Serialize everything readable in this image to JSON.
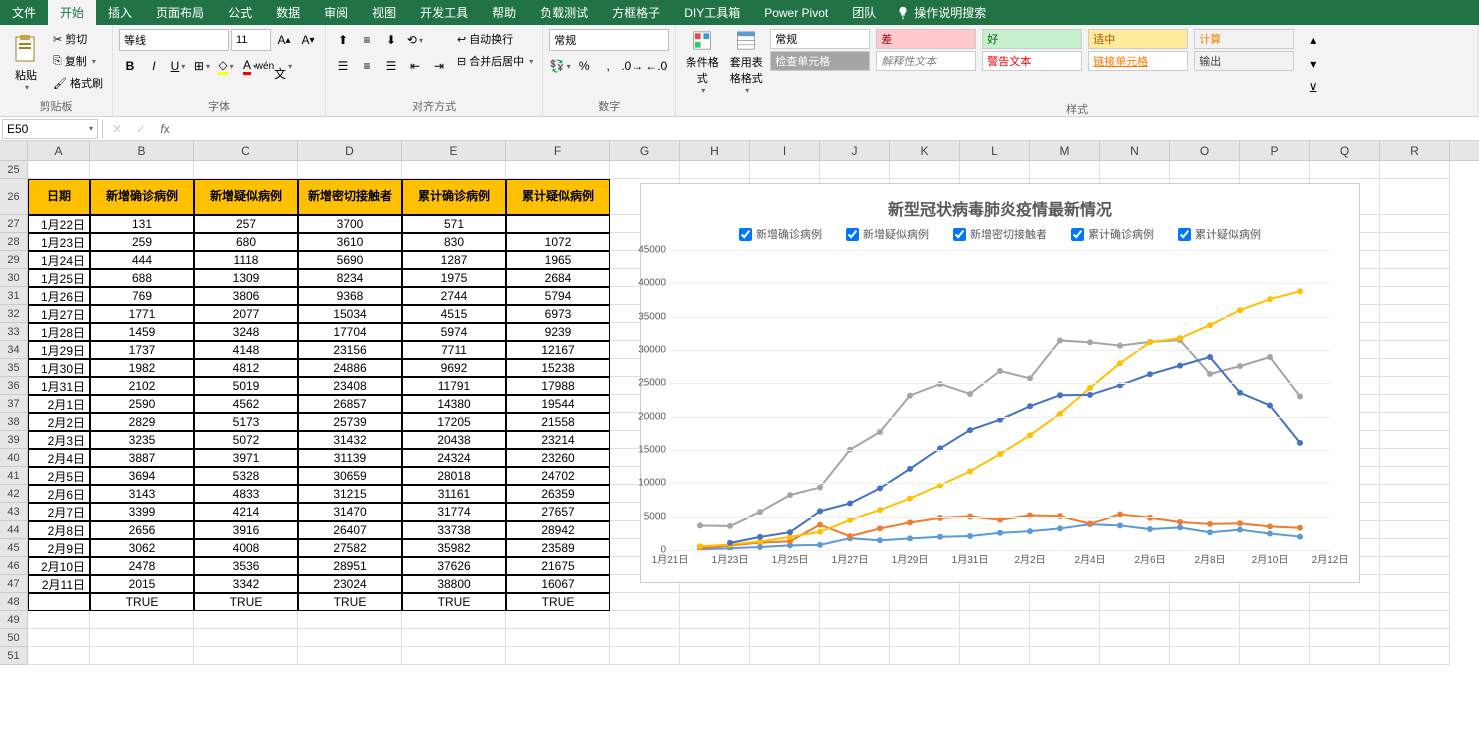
{
  "ribbon_tabs": [
    "文件",
    "开始",
    "插入",
    "页面布局",
    "公式",
    "数据",
    "审阅",
    "视图",
    "开发工具",
    "帮助",
    "负载测试",
    "方框格子",
    "DIY工具箱",
    "Power Pivot",
    "团队"
  ],
  "active_tab": "开始",
  "tellme": "操作说明搜索",
  "clipboard": {
    "paste": "粘贴",
    "cut": "剪切",
    "copy": "复制",
    "format_painter": "格式刷",
    "group": "剪贴板"
  },
  "font": {
    "name": "等线",
    "size": "11",
    "group": "字体",
    "bold": "B",
    "italic": "I",
    "underline": "U"
  },
  "alignment": {
    "wrap": "自动换行",
    "merge": "合并后居中",
    "group": "对齐方式"
  },
  "number": {
    "format": "常规",
    "group": "数字"
  },
  "cond_format": "条件格式",
  "table_format": "套用表格格式",
  "styles": {
    "group": "样式",
    "cells": [
      {
        "t": "常规",
        "bg": "#fff",
        "fg": "#000"
      },
      {
        "t": "差",
        "bg": "#ffc7ce",
        "fg": "#9c0006"
      },
      {
        "t": "好",
        "bg": "#c6efce",
        "fg": "#006100"
      },
      {
        "t": "适中",
        "bg": "#ffeb9c",
        "fg": "#9c5700"
      },
      {
        "t": "计算",
        "bg": "#f2f2f2",
        "fg": "#fa7d00"
      },
      {
        "t": "检查单元格",
        "bg": "#a5a5a5",
        "fg": "#fff"
      },
      {
        "t": "解释性文本",
        "bg": "#fff",
        "fg": "#7f7f7f",
        "italic": true
      },
      {
        "t": "警告文本",
        "bg": "#fff",
        "fg": "#ff0000"
      },
      {
        "t": "链接单元格",
        "bg": "#fff",
        "fg": "#fa7d00",
        "underline": true
      },
      {
        "t": "输出",
        "bg": "#f2f2f2",
        "fg": "#3f3f3f"
      }
    ]
  },
  "name_box": "E50",
  "formula": "",
  "columns": [
    "A",
    "B",
    "C",
    "D",
    "E",
    "F",
    "G",
    "H",
    "I",
    "J",
    "K",
    "L",
    "M",
    "N",
    "O",
    "P",
    "Q",
    "R"
  ],
  "table_headers": [
    "日期",
    "新增确诊病例",
    "新增疑似病例",
    "新增密切接触者",
    "累计确诊病例",
    "累计疑似病例"
  ],
  "data_rows": [
    [
      "1月22日",
      131,
      257,
      3700,
      571,
      ""
    ],
    [
      "1月23日",
      259,
      680,
      3610,
      830,
      1072
    ],
    [
      "1月24日",
      444,
      1118,
      5690,
      1287,
      1965
    ],
    [
      "1月25日",
      688,
      1309,
      8234,
      1975,
      2684
    ],
    [
      "1月26日",
      769,
      3806,
      9368,
      2744,
      5794
    ],
    [
      "1月27日",
      1771,
      2077,
      15034,
      4515,
      6973
    ],
    [
      "1月28日",
      1459,
      3248,
      17704,
      5974,
      9239
    ],
    [
      "1月29日",
      1737,
      4148,
      23156,
      7711,
      12167
    ],
    [
      "1月30日",
      1982,
      4812,
      24886,
      9692,
      15238
    ],
    [
      "1月31日",
      2102,
      5019,
      23408,
      11791,
      17988
    ],
    [
      "2月1日",
      2590,
      4562,
      26857,
      14380,
      19544
    ],
    [
      "2月2日",
      2829,
      5173,
      25739,
      17205,
      21558
    ],
    [
      "2月3日",
      3235,
      5072,
      31432,
      20438,
      23214
    ],
    [
      "2月4日",
      3887,
      3971,
      31139,
      24324,
      23260
    ],
    [
      "2月5日",
      3694,
      5328,
      30659,
      28018,
      24702
    ],
    [
      "2月6日",
      3143,
      4833,
      31215,
      31161,
      26359
    ],
    [
      "2月7日",
      3399,
      4214,
      31470,
      31774,
      27657
    ],
    [
      "2月8日",
      2656,
      3916,
      26407,
      33738,
      28942
    ],
    [
      "2月9日",
      3062,
      4008,
      27582,
      35982,
      23589
    ],
    [
      "2月10日",
      2478,
      3536,
      28951,
      37626,
      21675
    ],
    [
      "2月11日",
      2015,
      3342,
      23024,
      38800,
      16067
    ]
  ],
  "true_row": [
    "",
    "TRUE",
    "TRUE",
    "TRUE",
    "TRUE",
    "TRUE"
  ],
  "row_start": 25,
  "chart_data": {
    "type": "line",
    "title": "新型冠状病毒肺炎疫情最新情况",
    "x_categories": [
      "1月21日",
      "1月22日",
      "1月23日",
      "1月24日",
      "1月25日",
      "1月26日",
      "1月27日",
      "1月28日",
      "1月29日",
      "1月30日",
      "1月31日",
      "2月1日",
      "2月2日",
      "2月3日",
      "2月4日",
      "2月5日",
      "2月6日",
      "2月7日",
      "2月8日",
      "2月9日",
      "2月10日",
      "2月11日",
      "2月12日"
    ],
    "x_tick_labels": [
      "1月21日",
      "1月23日",
      "1月25日",
      "1月27日",
      "1月29日",
      "1月31日",
      "2月2日",
      "2月4日",
      "2月6日",
      "2月8日",
      "2月10日",
      "2月12日"
    ],
    "ylim": [
      0,
      45000
    ],
    "y_ticks": [
      0,
      5000,
      10000,
      15000,
      20000,
      25000,
      30000,
      35000,
      40000,
      45000
    ],
    "series": [
      {
        "name": "新增确诊病例",
        "color": "#5b9bd5",
        "values": [
          131,
          259,
          444,
          688,
          769,
          1771,
          1459,
          1737,
          1982,
          2102,
          2590,
          2829,
          3235,
          3887,
          3694,
          3143,
          3399,
          2656,
          3062,
          2478,
          2015
        ]
      },
      {
        "name": "新增疑似病例",
        "color": "#ed7d31",
        "values": [
          257,
          680,
          1118,
          1309,
          3806,
          2077,
          3248,
          4148,
          4812,
          5019,
          4562,
          5173,
          5072,
          3971,
          5328,
          4833,
          4214,
          3916,
          4008,
          3536,
          3342
        ]
      },
      {
        "name": "新增密切接触者",
        "color": "#a5a5a5",
        "values": [
          3700,
          3610,
          5690,
          8234,
          9368,
          15034,
          17704,
          23156,
          24886,
          23408,
          26857,
          25739,
          31432,
          31139,
          30659,
          31215,
          31470,
          26407,
          27582,
          28951,
          23024
        ]
      },
      {
        "name": "累计确诊病例",
        "color": "#ffc000",
        "values": [
          571,
          830,
          1287,
          1975,
          2744,
          4515,
          5974,
          7711,
          9692,
          11791,
          14380,
          17205,
          20438,
          24324,
          28018,
          31161,
          31774,
          33738,
          35982,
          37626,
          38800
        ]
      },
      {
        "name": "累计疑似病例",
        "color": "#4472c4",
        "values": [
          null,
          1072,
          1965,
          2684,
          5794,
          6973,
          9239,
          12167,
          15238,
          17988,
          19544,
          21558,
          23214,
          23260,
          24702,
          26359,
          27657,
          28942,
          23589,
          21675,
          16067
        ]
      }
    ]
  }
}
